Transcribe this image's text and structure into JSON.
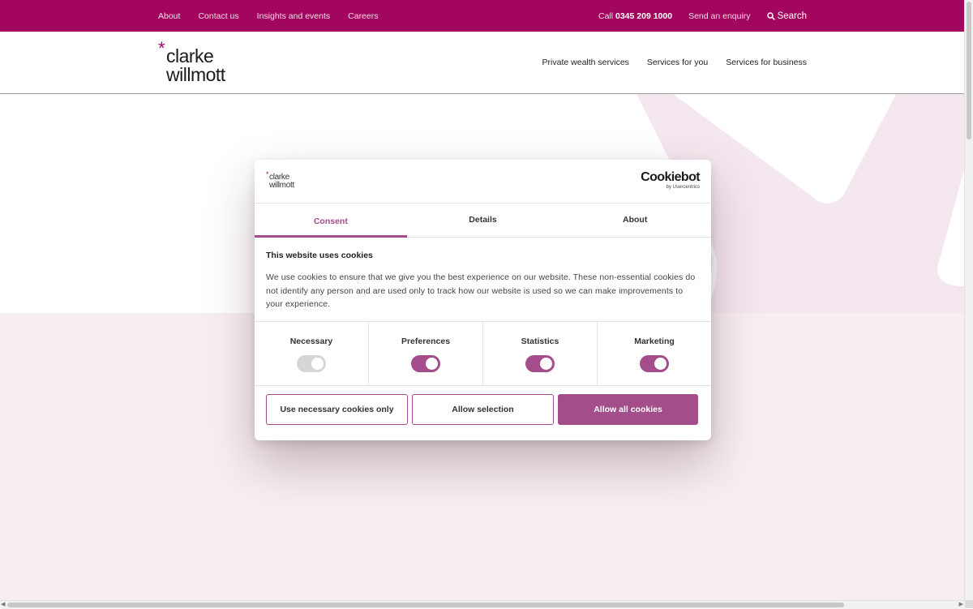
{
  "topbar": {
    "links": [
      "About",
      "Contact us",
      "Insights and events",
      "Careers"
    ],
    "call_prefix": "Call",
    "phone": "0345 209 1000",
    "enquiry": "Send an enquiry",
    "search": "Search"
  },
  "logo": {
    "star": "*",
    "line1": "clarke",
    "line2": "willmott"
  },
  "main_nav": [
    "Private wealth services",
    "Services for you",
    "Services for business"
  ],
  "colors": {
    "brand": "#a3065e",
    "accent": "#a34d8a",
    "hero_tint": "#f7eef3"
  },
  "cookie_dialog": {
    "logo": {
      "star": "*",
      "line1": "clarke",
      "line2": "willmott"
    },
    "provider": "Cookiebot",
    "provider_sub": "by Usercentrics",
    "tabs": [
      "Consent",
      "Details",
      "About"
    ],
    "active_tab": "Consent",
    "heading": "This website uses cookies",
    "body": "We use cookies to ensure that we give you the best experience on our website. These non-essential cookies do not identify any person and are used only to track how our website is used so we can make improvements to your experience.",
    "toggles": [
      {
        "label": "Necessary",
        "on": true,
        "disabled": true
      },
      {
        "label": "Preferences",
        "on": true,
        "disabled": false
      },
      {
        "label": "Statistics",
        "on": true,
        "disabled": false
      },
      {
        "label": "Marketing",
        "on": true,
        "disabled": false
      }
    ],
    "buttons": {
      "necessary_only": "Use necessary cookies only",
      "allow_selection": "Allow selection",
      "allow_all": "Allow all cookies"
    }
  }
}
